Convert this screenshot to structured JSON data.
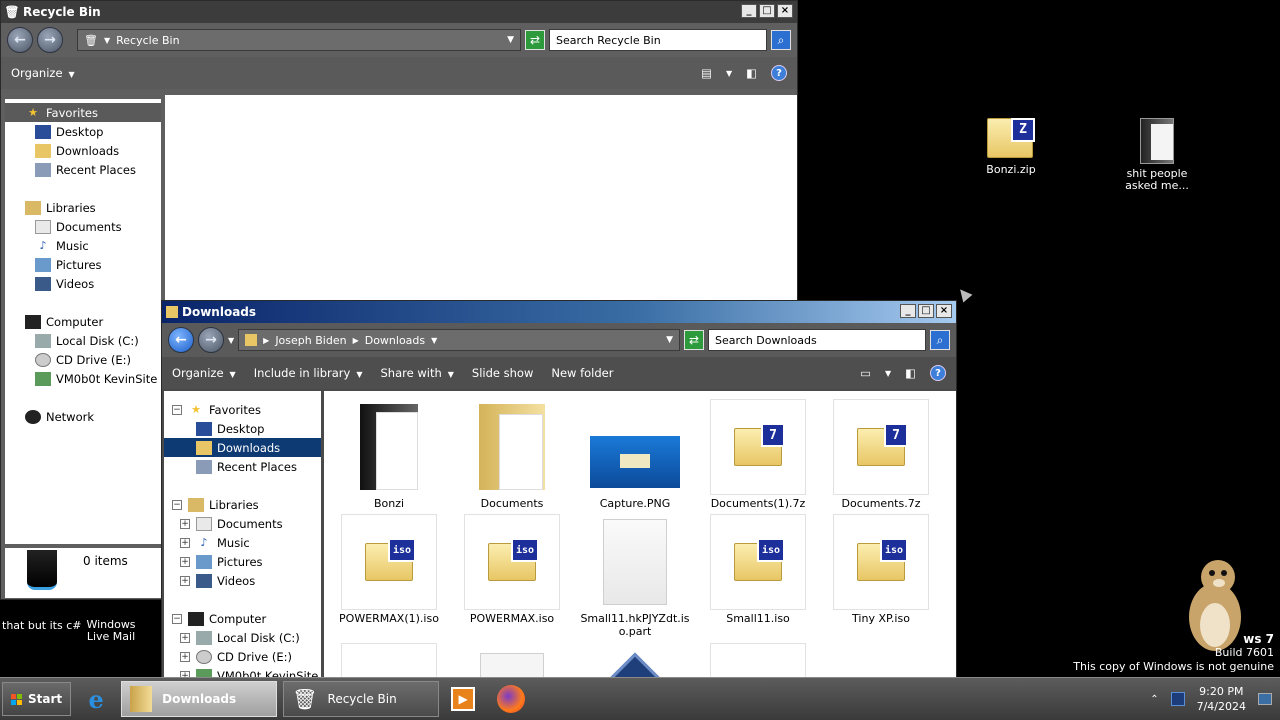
{
  "recycle_window": {
    "title": "Recycle Bin",
    "address": "Recycle Bin",
    "search_placeholder": "Search Recycle Bin",
    "organize": "Organize",
    "status": "0 items",
    "nav": {
      "favorites": "Favorites",
      "favorites_items": [
        "Desktop",
        "Downloads",
        "Recent Places"
      ],
      "libraries": "Libraries",
      "libraries_items": [
        "Documents",
        "Music",
        "Pictures",
        "Videos"
      ],
      "computer": "Computer",
      "computer_items": [
        "Local Disk (C:)",
        "CD Drive (E:)",
        "VM0b0t KevinSite"
      ],
      "network": "Network"
    }
  },
  "downloads_window": {
    "title": "Downloads",
    "breadcrumb": [
      "Joseph Biden",
      "Downloads"
    ],
    "search_placeholder": "Search Downloads",
    "toolbar": {
      "organize": "Organize",
      "include": "Include in library",
      "share": "Share with",
      "slideshow": "Slide show",
      "newfolder": "New folder"
    },
    "nav": {
      "favorites": "Favorites",
      "favorites_items": [
        "Desktop",
        "Downloads",
        "Recent Places"
      ],
      "libraries": "Libraries",
      "libraries_items": [
        "Documents",
        "Music",
        "Pictures",
        "Videos"
      ],
      "computer": "Computer",
      "computer_items": [
        "Local Disk (C:)",
        "CD Drive (E:)",
        "VM0b0t KevinSite"
      ]
    },
    "files": [
      {
        "name": "Bonzi",
        "kind": "folder-dark"
      },
      {
        "name": "Documents",
        "kind": "folder"
      },
      {
        "name": "Capture.PNG",
        "kind": "image"
      },
      {
        "name": "Documents(1).7z",
        "kind": "7z"
      },
      {
        "name": "Documents.7z",
        "kind": "7z"
      },
      {
        "name": "POWERMAX(1).iso",
        "kind": "iso"
      },
      {
        "name": "POWERMAX.iso",
        "kind": "iso"
      },
      {
        "name": "Small11.hkPJYZdt.iso.part",
        "kind": "blank"
      },
      {
        "name": "Small11.iso",
        "kind": "iso"
      },
      {
        "name": "Tiny XP.iso",
        "kind": "iso"
      }
    ]
  },
  "desktop": {
    "icons": [
      {
        "label": "Bonzi.zip"
      },
      {
        "label": "shit people asked me..."
      }
    ],
    "left_labels": [
      "that but its c#",
      "Windows Live Mail"
    ],
    "watermark": {
      "line1": "ws 7",
      "line2": "Build 7601",
      "line3": "This copy of Windows is not genuine"
    }
  },
  "taskbar": {
    "start": "Start",
    "tasks": [
      "Downloads",
      "Recycle Bin"
    ],
    "time": "9:20 PM",
    "date": "7/4/2024"
  }
}
